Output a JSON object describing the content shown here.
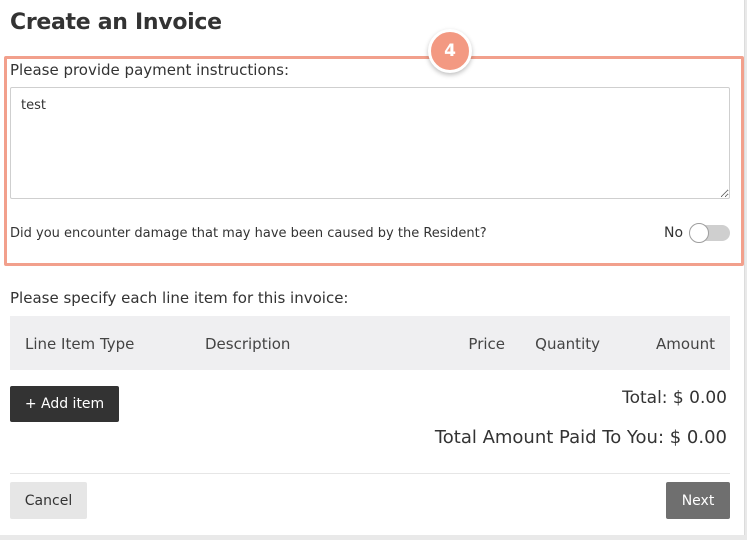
{
  "header": {
    "title": "Create an Invoice"
  },
  "step": {
    "number": "4",
    "highlight_color": "#f2a08c",
    "badge_color": "#f39982"
  },
  "payment": {
    "label": "Please provide payment instructions:",
    "value": "test"
  },
  "damage": {
    "question": "Did you encounter damage that may have been caused by the Resident?",
    "toggle_label": "No",
    "toggle_on": false
  },
  "line_items": {
    "label": "Please specify each line item for this invoice:",
    "columns": [
      "Line Item Type",
      "Description",
      "Price",
      "Quantity",
      "Amount"
    ],
    "add_button": "+ Add item"
  },
  "totals": {
    "total": "Total: $ 0.00",
    "paid_to_you": "Total Amount Paid To You: $ 0.00"
  },
  "footer": {
    "cancel": "Cancel",
    "next": "Next"
  }
}
